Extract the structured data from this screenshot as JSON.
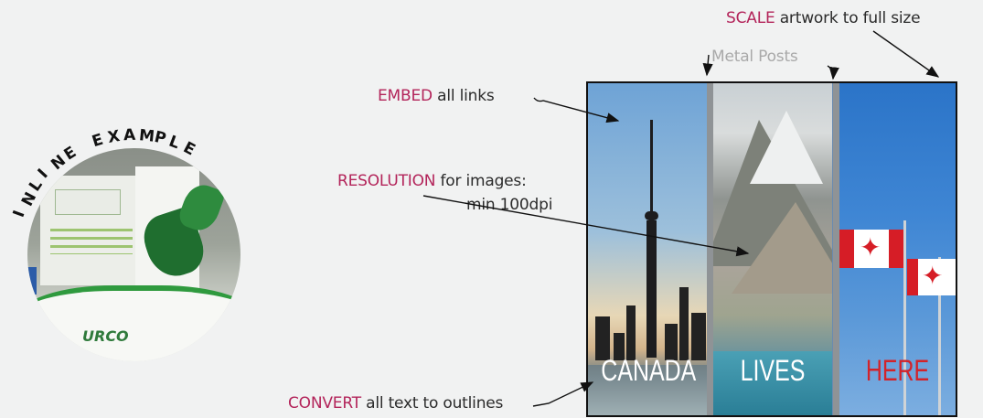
{
  "callouts": {
    "scale": {
      "keyword": "SCALE",
      "rest": " artwork to full size"
    },
    "metal_posts": "Metal Posts",
    "embed": {
      "keyword": "EMBED",
      "rest": " all links"
    },
    "resolution": {
      "keyword": "RESOLUTION",
      "rest": " for images:",
      "line2": "min 100dpi"
    },
    "convert": {
      "keyword": "CONVERT",
      "rest": " all text to outlines"
    }
  },
  "inline_example": {
    "heading": "INLINE EXAMPLE",
    "photo_text": "URCO"
  },
  "artwork": {
    "panels": [
      {
        "word": "CANADA",
        "scene": "city skyline with tower"
      },
      {
        "word": "LIVES",
        "scene": "mountain and lake"
      },
      {
        "word": "HERE",
        "scene": "canadian flags"
      }
    ]
  },
  "colors": {
    "keyword": "#b3245a",
    "label": "#2b2b2b",
    "secondary": "#a9a9a9",
    "here_text": "#d2232a",
    "background": "#f1f2f2"
  }
}
